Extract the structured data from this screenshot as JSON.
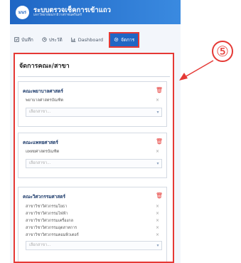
{
  "header": {
    "logo_text": "มนร",
    "title": "ระบบตรวจเช็คการเข้าแถว",
    "subtitle": "มหาวิทยาลัยนราธิวาสราชนครินทร์"
  },
  "tabs": [
    {
      "icon": "check-icon",
      "label": "บันทึก"
    },
    {
      "icon": "history-icon",
      "label": "ประวัติ"
    },
    {
      "icon": "dashboard-icon",
      "label": "Dashboard"
    },
    {
      "icon": "gear-icon",
      "label": "จัดการ"
    }
  ],
  "panel": {
    "title": "จัดการคณะ/สาขา",
    "select_placeholder": "เลือกสาขา...",
    "faculties": [
      {
        "name": "คณะพยาบาลศาสตร์",
        "programs": [
          "พยาบาลศาสตรบัณฑิต"
        ]
      },
      {
        "name": "คณะแพทยศาสตร์",
        "programs": [
          "แพทยศาสตรบัณฑิต"
        ]
      },
      {
        "name": "คณะวิศวกรรมศาสตร์",
        "programs": [
          "สาขาวิชาวิศวกรรมโยธา",
          "สาขาวิชาวิศวกรรมไฟฟ้า",
          "สาขาวิชาวิศวกรรมเครื่องกล",
          "สาขาวิชาวิศวกรรมอุตสาหการ",
          "สาขาวิชาวิศวกรรมคอมพิวเตอร์"
        ]
      }
    ]
  },
  "annotation": {
    "number": "⑤"
  },
  "colors": {
    "primary": "#1f66c4",
    "highlight": "#e53935"
  }
}
